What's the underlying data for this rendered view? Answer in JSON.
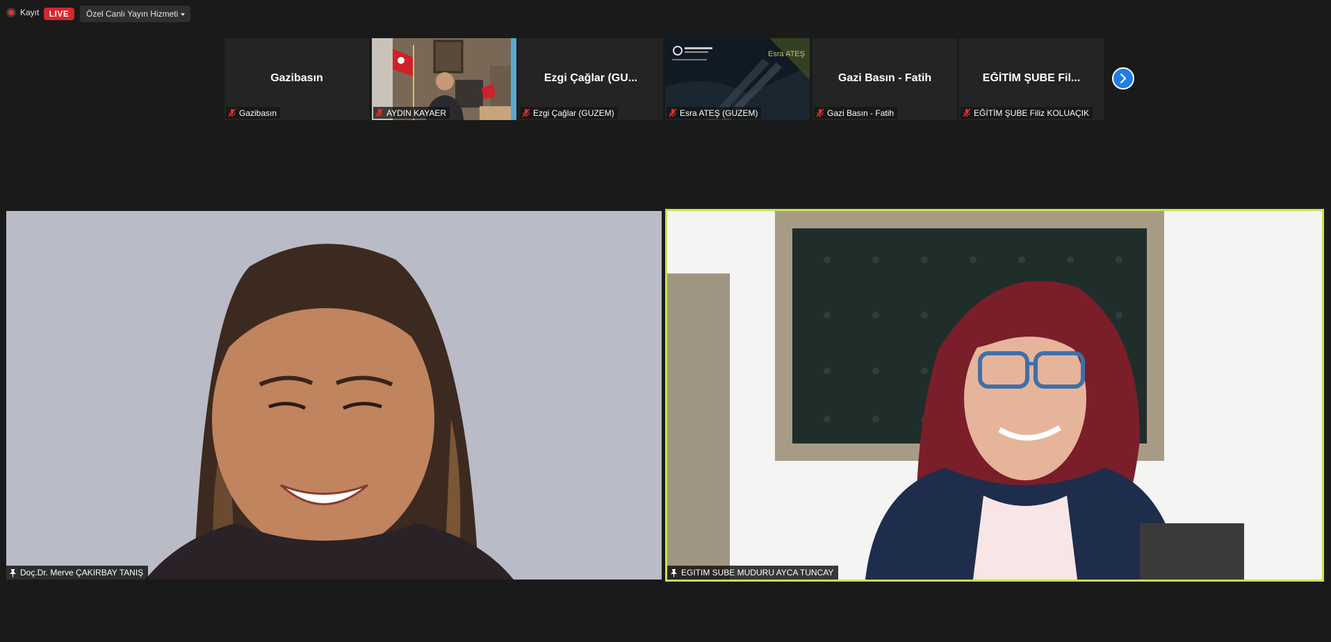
{
  "topbar": {
    "record_label": "Kayıt",
    "live_label": "LIVE",
    "stream_service_label": "Özel Canlı Yayın Hizmeti"
  },
  "gallery": {
    "thumbnails": [
      {
        "display_name": "Gazibasın",
        "tag": "Gazibasın",
        "video": false
      },
      {
        "display_name": "",
        "tag": "AYDIN KAYAER",
        "video": true
      },
      {
        "display_name": "Ezgi Çağlar (GU...",
        "tag": "Ezgi Çağlar (GUZEM)",
        "video": false
      },
      {
        "display_name": "",
        "tag": "Esra ATEŞ (GUZEM)",
        "video": true,
        "overlay_text": "Esra ATEŞ"
      },
      {
        "display_name": "Gazi Basın - Fatih",
        "tag": "Gazi Basın - Fatih",
        "video": false
      },
      {
        "display_name": "EĞİTİM ŞUBE Fil...",
        "tag": "EĞİTİM ŞUBE Filiz KOLUAÇIK",
        "video": false
      }
    ],
    "next_page_icon": "chevron-right-icon"
  },
  "speakers": {
    "left": {
      "name": "Doç.Dr. Merve ÇAKIRBAY TANIŞ"
    },
    "right": {
      "name": "EGITIM SUBE MUDURU AYCA TUNCAY",
      "active_speaker": true
    }
  },
  "colors": {
    "background": "#1a1a1a",
    "live_badge": "#d8262e",
    "active_speaker_border": "#c8e34a",
    "next_button": "#1f7de6",
    "muted_mic": "#e5302a"
  }
}
